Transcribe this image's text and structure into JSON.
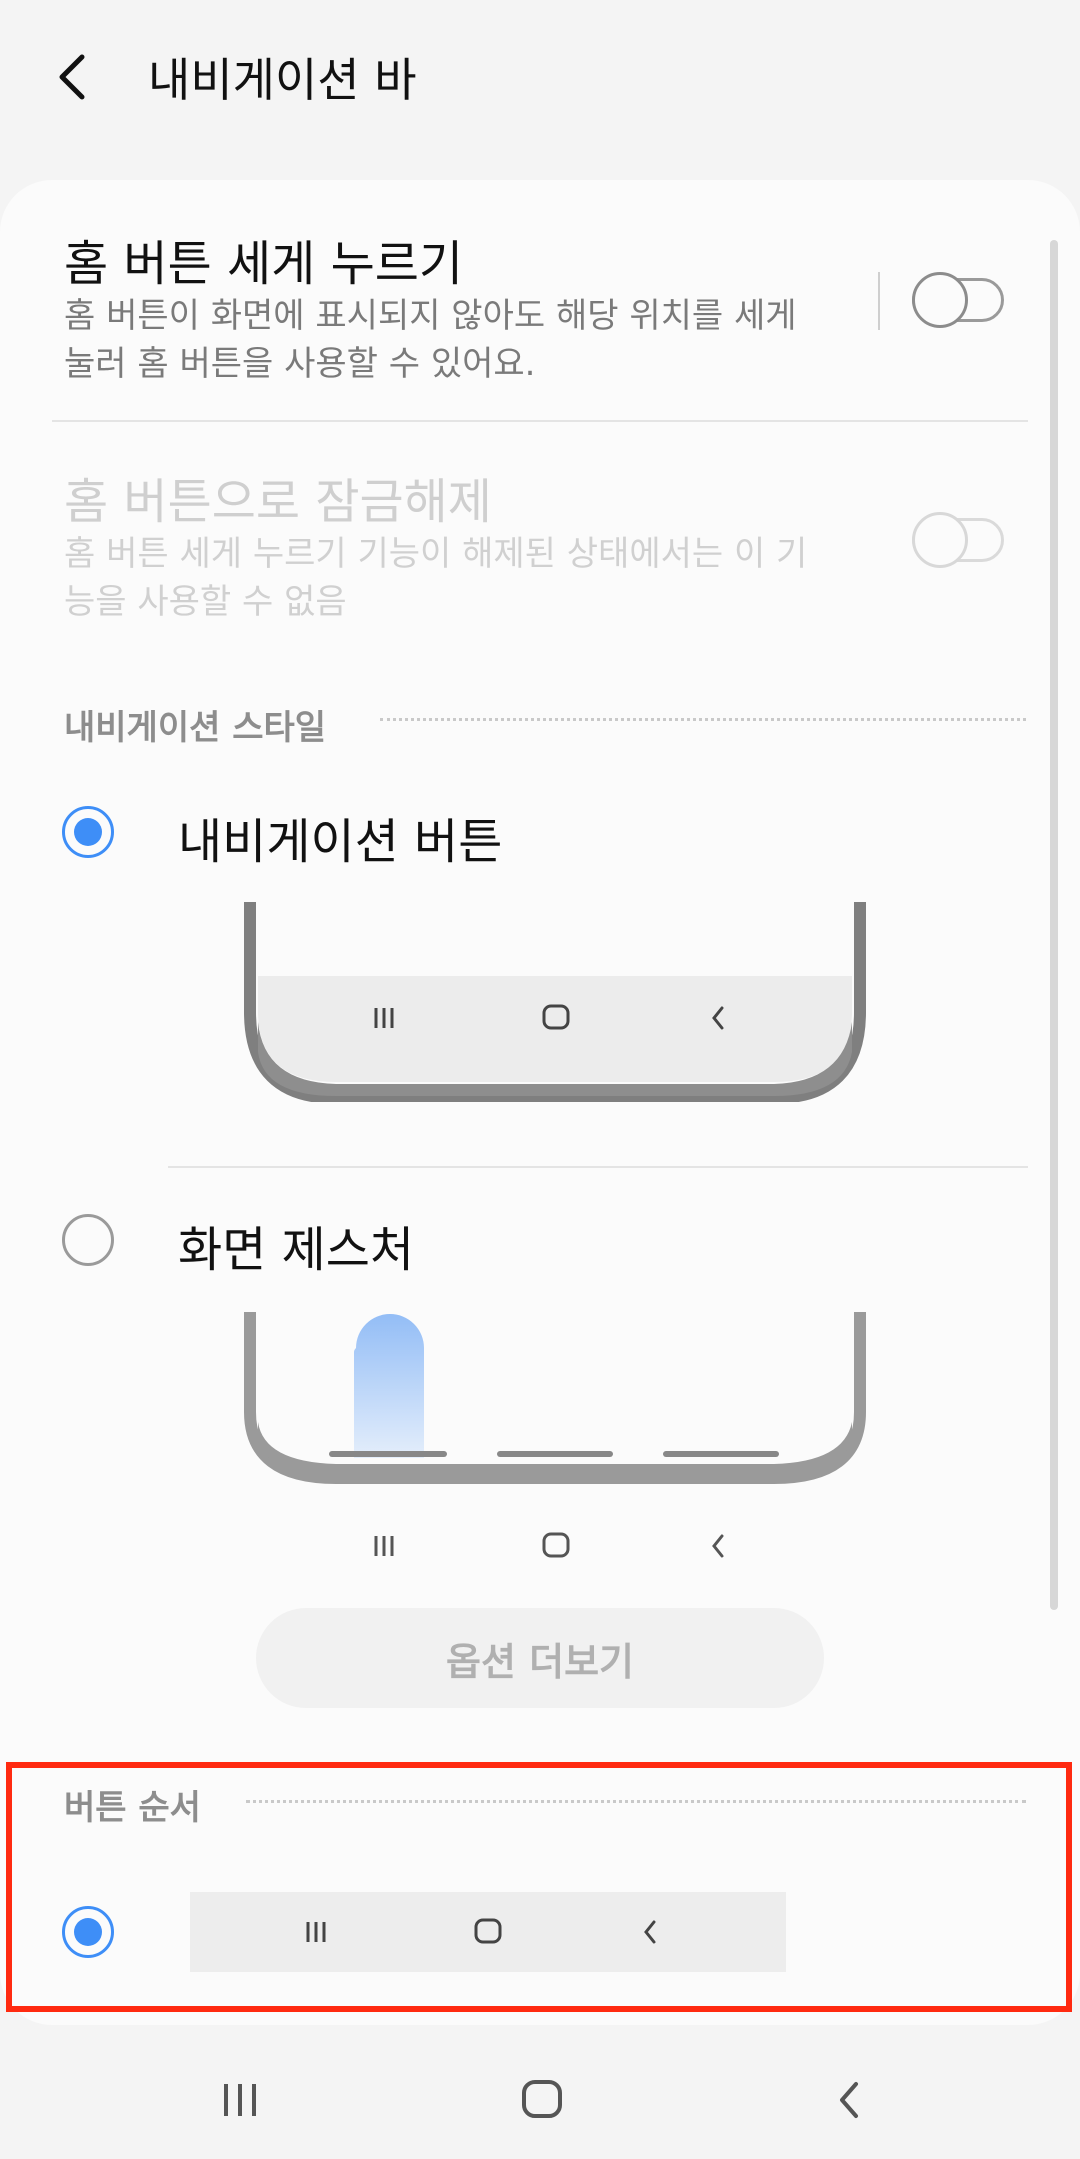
{
  "header": {
    "title": "내비게이션 바"
  },
  "settings": {
    "home_press": {
      "title": "홈 버튼 세게 누르기",
      "description": "홈 버튼이 화면에 표시되지 않아도 해당 위치를 세게 눌러 홈 버튼을 사용할 수 있어요.",
      "enabled": false
    },
    "home_unlock": {
      "title": "홈 버튼으로 잠금해제",
      "description": "홈 버튼 세게 누르기 기능이 해제된 상태에서는 이 기능을 사용할 수 없음",
      "enabled": false,
      "disabled": true
    }
  },
  "nav_style": {
    "section_title": "내비게이션 스타일",
    "options": [
      {
        "label": "내비게이션 버튼",
        "selected": true
      },
      {
        "label": "화면 제스처",
        "selected": false
      }
    ],
    "more_options_label": "옵션 더보기"
  },
  "button_order": {
    "section_title": "버튼 순서",
    "options": [
      {
        "selected": true,
        "icons": [
          "recents-icon",
          "home-icon",
          "back-icon"
        ]
      }
    ]
  },
  "system_nav": {
    "icons": [
      "recents-icon",
      "home-icon",
      "back-icon"
    ]
  },
  "colors": {
    "accent": "#3e8ef7",
    "highlight": "#ff2a10",
    "background": "#f4f4f4",
    "card": "#fbfbfb"
  }
}
